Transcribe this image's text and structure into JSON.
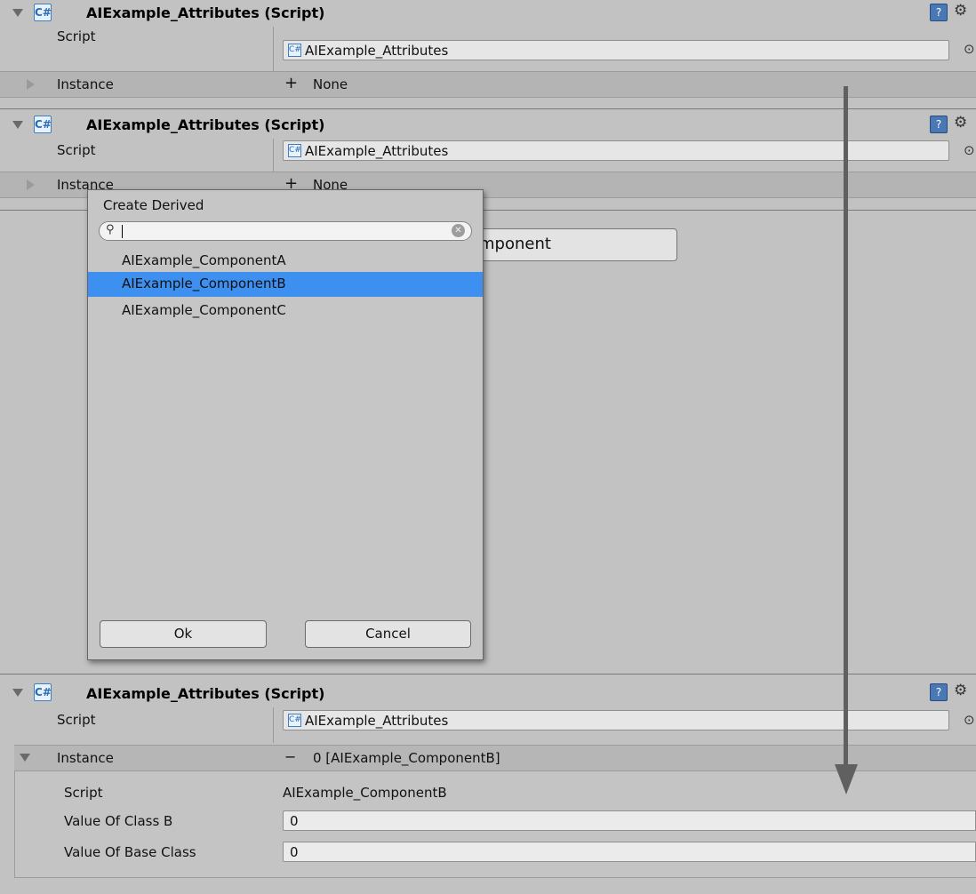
{
  "components": [
    {
      "title": "AIExample_Attributes (Script)",
      "script_label": "Script",
      "script_value": "AIExample_Attributes",
      "instance_label": "Instance",
      "instance_value": "None",
      "instance_symbol": "+"
    },
    {
      "title": "AIExample_Attributes (Script)",
      "script_label": "Script",
      "script_value": "AIExample_Attributes",
      "instance_label": "Instance",
      "instance_value": "None",
      "instance_symbol": "+"
    },
    {
      "title": "AIExample_Attributes (Script)",
      "script_label": "Script",
      "script_value": "AIExample_Attributes",
      "instance_label": "Instance",
      "instance_value": "0 [AIExample_ComponentB]",
      "instance_symbol": "−",
      "fields": [
        {
          "label": "Script",
          "value": "AIExample_ComponentB"
        },
        {
          "label": "Value Of Class B",
          "value": "0"
        },
        {
          "label": "Value Of Base Class",
          "value": "0"
        }
      ]
    }
  ],
  "add_button_label": "mponent",
  "popup": {
    "title": "Create Derived",
    "search_value": "",
    "items": [
      "AIExample_ComponentA",
      "AIExample_ComponentB",
      "AIExample_ComponentC"
    ],
    "selected_index": 1,
    "ok_label": "Ok",
    "cancel_label": "Cancel"
  },
  "icons": {
    "cs_glyph": "C#",
    "help_glyph": "?",
    "gear_glyph": "⚙",
    "picker_glyph": "⊙",
    "search_glyph": "⚲",
    "clear_glyph": "✕"
  },
  "colors": {
    "background": "#c2c2c2",
    "selection": "#3d8ff0",
    "arrow": "#606060"
  }
}
